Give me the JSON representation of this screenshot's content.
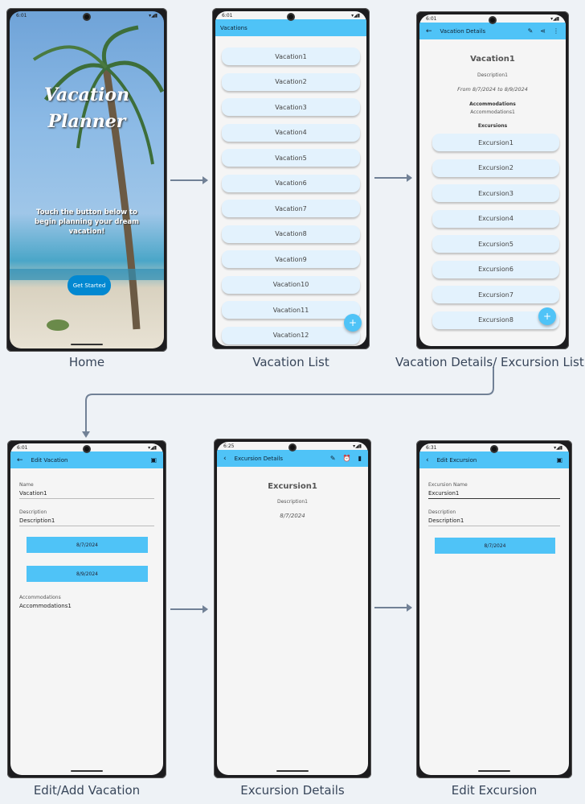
{
  "captions": {
    "home": "Home",
    "vacation_list": "Vacation List",
    "vacation_details": "Vacation Details/ Excursion List",
    "edit_vacation": "Edit/Add Vacation",
    "excursion_details": "Excursion Details",
    "edit_excursion": "Edit Excursion"
  },
  "status_bar": {
    "time": "6:01",
    "time2": "6:25",
    "time3": "6:31",
    "icons_right": "▾◢▮"
  },
  "home": {
    "title_line1": "Vacation",
    "title_line2": "Planner",
    "message": "Touch the button below to begin planning your dream vacation!",
    "button": "Get Started"
  },
  "vacation_list": {
    "appbar_title": "Vacations",
    "items": [
      "Vacation1",
      "Vacation2",
      "Vacation3",
      "Vacation4",
      "Vacation5",
      "Vacation6",
      "Vacation7",
      "Vacation8",
      "Vacation9",
      "Vacation10",
      "Vacation11",
      "Vacation12"
    ],
    "fab": "+"
  },
  "vacation_details": {
    "appbar_title": "Vacation Details",
    "name": "Vacation1",
    "description": "Description1",
    "dates": "From 8/7/2024 to 8/9/2024",
    "accommodations_label": "Accommodations",
    "accommodations": "Accommodations1",
    "excursions_label": "Excursions",
    "excursions": [
      "Excursion1",
      "Excursion2",
      "Excursion3",
      "Excursion4",
      "Excursion5",
      "Excursion6",
      "Excursion7",
      "Excursion8"
    ],
    "fab": "+"
  },
  "edit_vacation": {
    "appbar_title": "Edit Vacation",
    "name_label": "Name",
    "name_value": "Vacation1",
    "description_label": "Description",
    "description_value": "Description1",
    "start_date": "8/7/2024",
    "end_date": "8/9/2024",
    "accommodations_label": "Accommodations",
    "accommodations_value": "Accommodations1"
  },
  "excursion_details": {
    "appbar_title": "Excursion Details",
    "name": "Excursion1",
    "description": "Description1",
    "date": "8/7/2024"
  },
  "edit_excursion": {
    "appbar_title": "Edit Excursion",
    "name_label": "Excursion Name",
    "name_value": "Excursion1",
    "description_label": "Description",
    "description_value": "Description1",
    "date": "8/7/2024"
  },
  "colors": {
    "accent": "#4fc3f7",
    "pill": "#e3f2fd",
    "button": "#0288d1",
    "arrow": "#718196"
  }
}
